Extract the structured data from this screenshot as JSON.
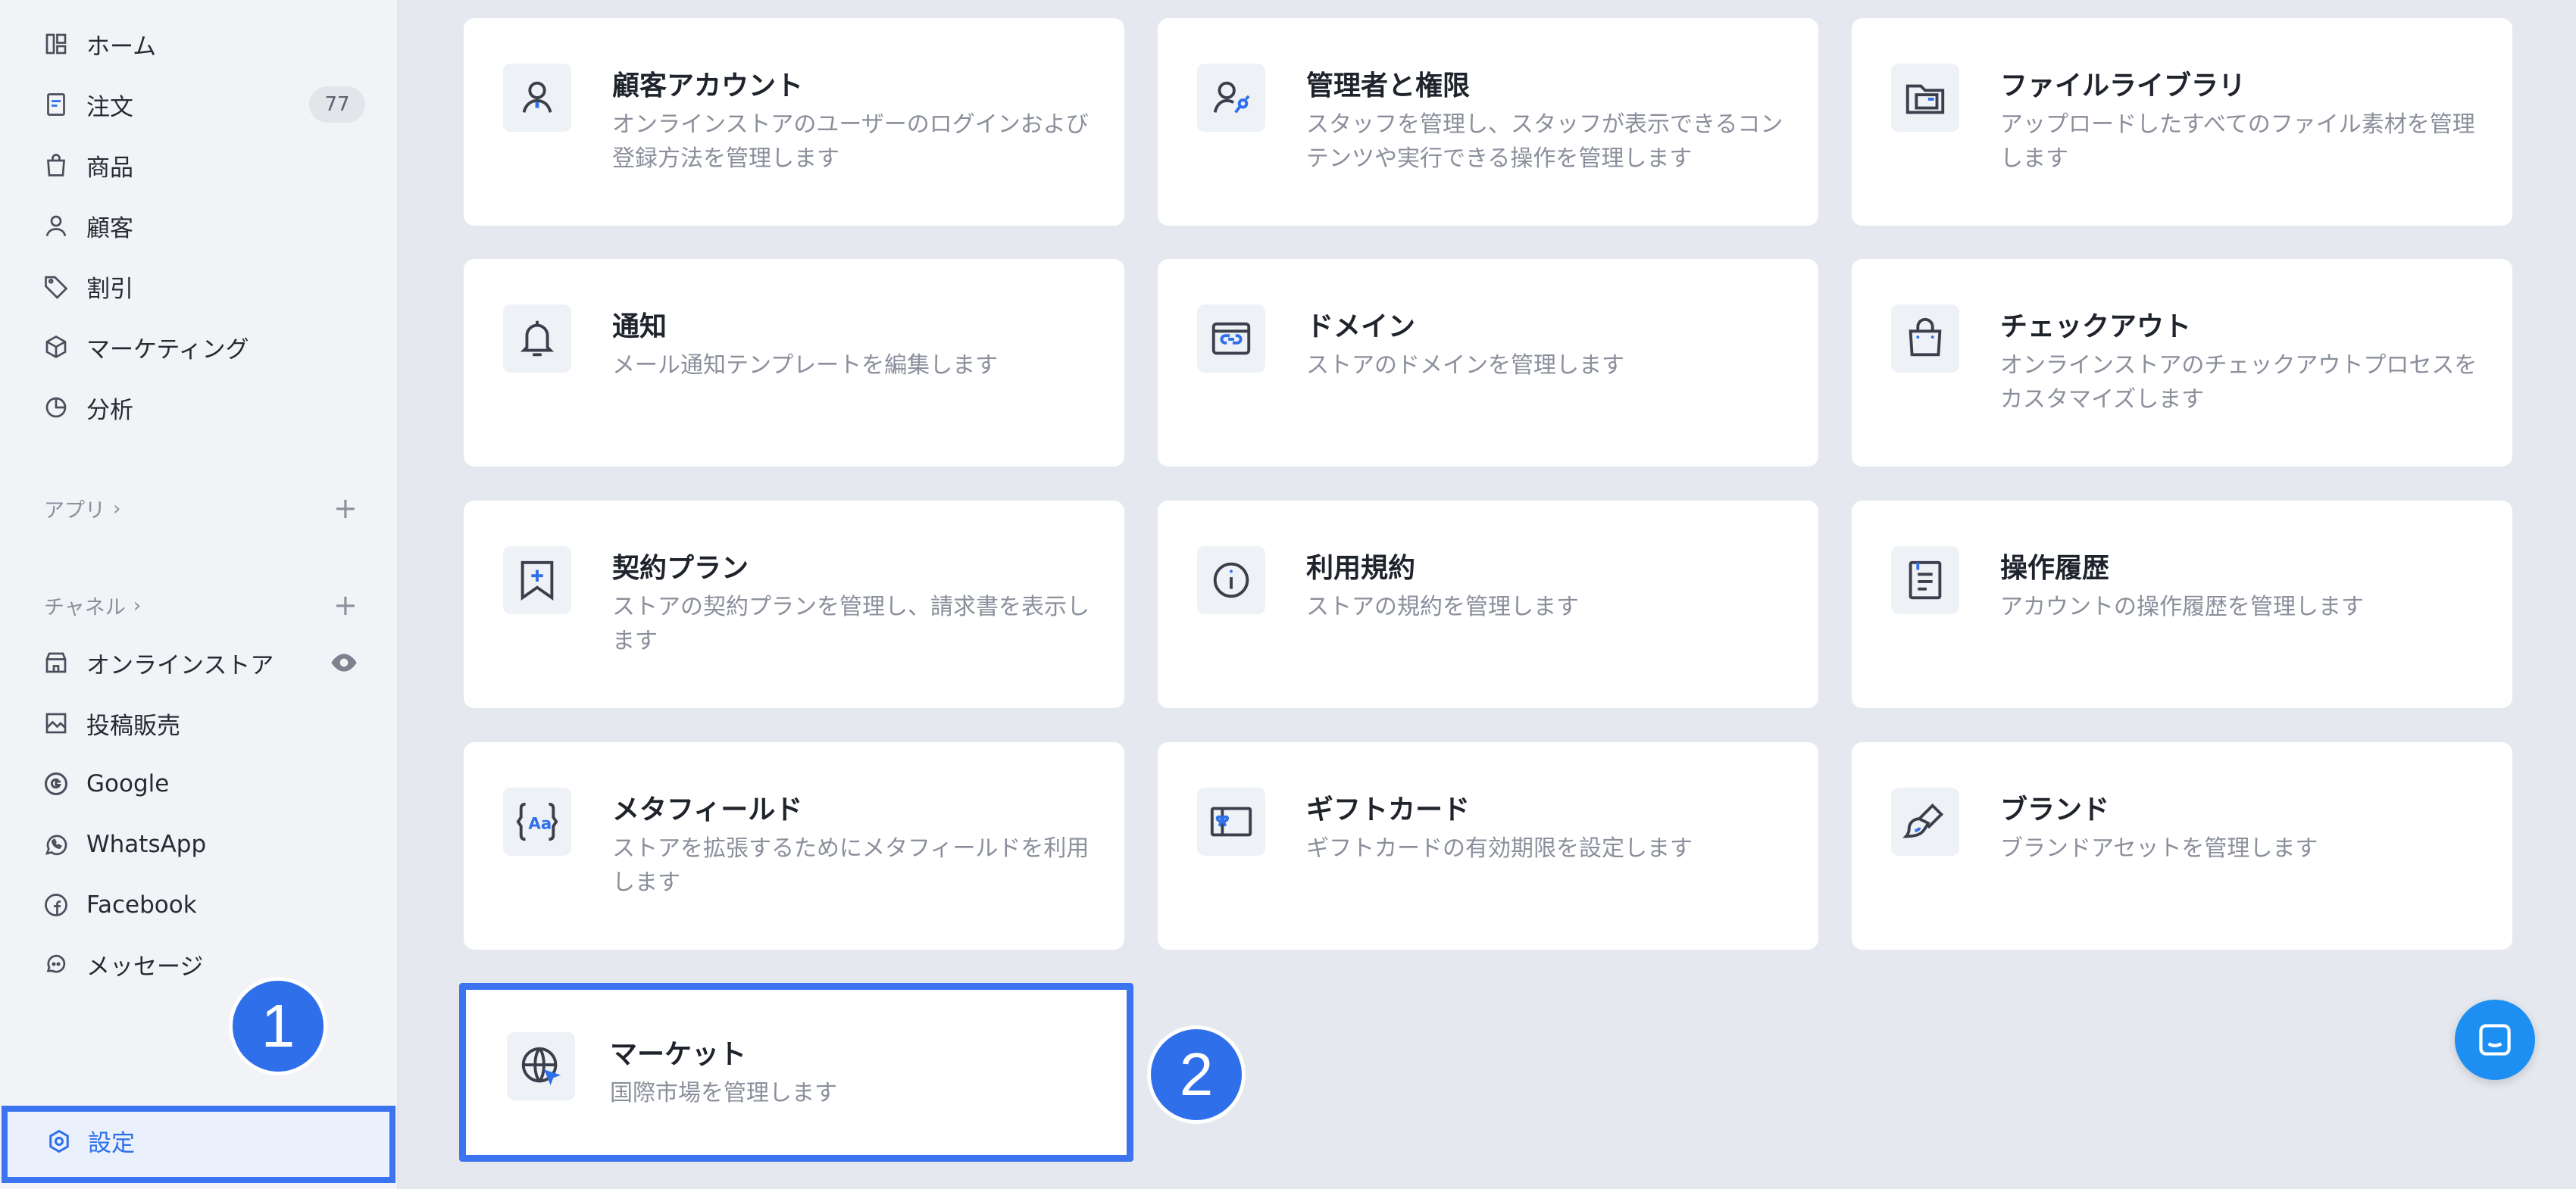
{
  "sidebar": {
    "items": [
      {
        "label": "ホーム",
        "icon": "home-icon"
      },
      {
        "label": "注文",
        "icon": "orders-icon",
        "badge": "77"
      },
      {
        "label": "商品",
        "icon": "products-icon"
      },
      {
        "label": "顧客",
        "icon": "customers-icon"
      },
      {
        "label": "割引",
        "icon": "discount-icon"
      },
      {
        "label": "マーケティング",
        "icon": "marketing-icon"
      },
      {
        "label": "分析",
        "icon": "analytics-icon"
      }
    ],
    "apps_label": "アプリ",
    "channels_label": "チャネル",
    "channels": [
      {
        "label": "オンラインストア",
        "icon": "online-store-icon"
      },
      {
        "label": "投稿販売",
        "icon": "post-sales-icon"
      },
      {
        "label": "Google",
        "icon": "google-icon"
      },
      {
        "label": "WhatsApp",
        "icon": "whatsapp-icon"
      },
      {
        "label": "Facebook",
        "icon": "facebook-icon"
      },
      {
        "label": "メッセージ",
        "icon": "message-icon"
      }
    ],
    "settings_label": "設定"
  },
  "steps": {
    "one": "1",
    "two": "2"
  },
  "cards": [
    {
      "title": "顧客アカウント",
      "desc": "オンラインストアのユーザーのログインおよび登録方法を管理します",
      "icon": "customer-account-icon"
    },
    {
      "title": "管理者と権限",
      "desc": "スタッフを管理し、スタッフが表示できるコンテンツや実行できる操作を管理します",
      "icon": "admin-permissions-icon"
    },
    {
      "title": "ファイルライブラリ",
      "desc": "アップロードしたすべてのファイル素材を管理します",
      "icon": "file-library-icon"
    },
    {
      "title": "通知",
      "desc": "メール通知テンプレートを編集します",
      "icon": "bell-icon"
    },
    {
      "title": "ドメイン",
      "desc": "ストアのドメインを管理します",
      "icon": "domain-icon"
    },
    {
      "title": "チェックアウト",
      "desc": "オンラインストアのチェックアウトプロセスをカスタマイズします",
      "icon": "checkout-bag-icon"
    },
    {
      "title": "契約プラン",
      "desc": "ストアの契約プランを管理し、請求書を表示します",
      "icon": "plan-bookmark-icon"
    },
    {
      "title": "利用規約",
      "desc": "ストアの規約を管理します",
      "icon": "info-icon"
    },
    {
      "title": "操作履歴",
      "desc": "アカウントの操作履歴を管理します",
      "icon": "history-doc-icon"
    },
    {
      "title": "メタフィールド",
      "desc": "ストアを拡張するためにメタフィールドを利用します",
      "icon": "metafield-icon"
    },
    {
      "title": "ギフトカード",
      "desc": "ギフトカードの有効期限を設定します",
      "icon": "gift-card-icon"
    },
    {
      "title": "ブランド",
      "desc": "ブランドアセットを管理します",
      "icon": "brand-brush-icon"
    },
    {
      "title": "マーケット",
      "desc": "国際市場を管理します",
      "icon": "globe-cursor-icon"
    }
  ],
  "colors": {
    "accent": "#3b73f0",
    "chat": "#1e8ff2"
  }
}
